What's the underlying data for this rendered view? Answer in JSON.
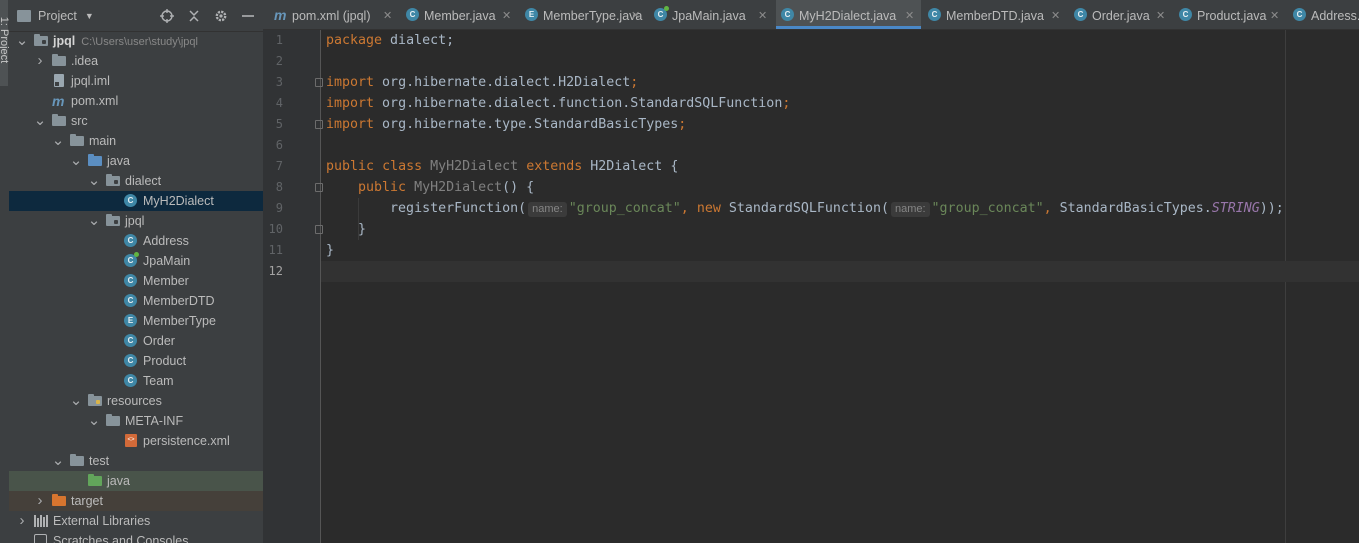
{
  "sidebar_tab_label": "1: Project",
  "panel": {
    "title": "Project",
    "icons": [
      "crosshair-icon",
      "collapse-all-icon",
      "gear-icon",
      "minimize-icon"
    ]
  },
  "tree": [
    {
      "label": "jpql",
      "path": "C:\\Users\\user\\study\\jpql",
      "icon": "module-folder",
      "level": 0,
      "expanded": true
    },
    {
      "label": ".idea",
      "icon": "folder",
      "level": 1,
      "expanded": false
    },
    {
      "label": "jpql.iml",
      "icon": "iml-file",
      "level": 1
    },
    {
      "label": "pom.xml",
      "icon": "maven-file",
      "level": 1
    },
    {
      "label": "src",
      "icon": "folder",
      "level": 1,
      "expanded": true
    },
    {
      "label": "main",
      "icon": "folder",
      "level": 2,
      "expanded": true
    },
    {
      "label": "java",
      "icon": "source-folder",
      "level": 3,
      "expanded": true
    },
    {
      "label": "dialect",
      "icon": "package",
      "level": 4,
      "expanded": true
    },
    {
      "label": "MyH2Dialect",
      "icon": "class",
      "level": 5,
      "selected": true
    },
    {
      "label": "jpql",
      "icon": "package",
      "level": 4,
      "expanded": true
    },
    {
      "label": "Address",
      "icon": "class",
      "level": 5
    },
    {
      "label": "JpaMain",
      "icon": "main-class",
      "level": 5
    },
    {
      "label": "Member",
      "icon": "class",
      "level": 5
    },
    {
      "label": "MemberDTD",
      "icon": "class",
      "level": 5
    },
    {
      "label": "MemberType",
      "icon": "enum",
      "level": 5
    },
    {
      "label": "Order",
      "icon": "class",
      "level": 5
    },
    {
      "label": "Product",
      "icon": "class",
      "level": 5
    },
    {
      "label": "Team",
      "icon": "class",
      "level": 5
    },
    {
      "label": "resources",
      "icon": "resources-folder",
      "level": 3,
      "expanded": true
    },
    {
      "label": "META-INF",
      "icon": "folder",
      "level": 4,
      "expanded": true
    },
    {
      "label": "persistence.xml",
      "icon": "xml-file",
      "level": 5
    },
    {
      "label": "test",
      "icon": "folder",
      "level": 2,
      "expanded": true
    },
    {
      "label": "java",
      "icon": "test-folder",
      "level": 3
    },
    {
      "label": "target",
      "icon": "excluded-folder",
      "level": 1,
      "expanded": false
    },
    {
      "label": "External Libraries",
      "icon": "libraries",
      "level": 0,
      "expanded": false
    },
    {
      "label": "Scratches and Consoles",
      "icon": "scratches",
      "level": 0
    }
  ],
  "tabs": [
    {
      "label": "pom.xml (jpql)",
      "icon": "maven-file",
      "close": true
    },
    {
      "label": "Member.java",
      "icon": "class",
      "close": true
    },
    {
      "label": "MemberType.java",
      "icon": "enum",
      "close": true
    },
    {
      "label": "JpaMain.java",
      "icon": "main-class",
      "close": true
    },
    {
      "label": "MyH2Dialect.java",
      "icon": "class",
      "close": true,
      "active": true
    },
    {
      "label": "MemberDTD.java",
      "icon": "class",
      "close": true
    },
    {
      "label": "Order.java",
      "icon": "class",
      "close": true
    },
    {
      "label": "Product.java",
      "icon": "class",
      "close": true
    },
    {
      "label": "Address.ja",
      "icon": "class",
      "close": false
    }
  ],
  "code": {
    "line_numbers": [
      "1",
      "2",
      "3",
      "4",
      "5",
      "6",
      "7",
      "8",
      "9",
      "10",
      "11",
      "12"
    ],
    "tokens": {
      "package_kw": "package",
      "package_name": " dialect;",
      "import_kw": "import",
      "import1": " org.hibernate.dialect.H2Dialect",
      "import2": " org.hibernate.dialect.function.StandardSQLFunction",
      "import3": " org.hibernate.type.StandardBasicTypes",
      "semi": ";",
      "public_kw": "public",
      "class_kw": "class",
      "class_name": "MyH2Dialect",
      "extends_kw": "extends",
      "super_name": "H2Dialect",
      "open_brace": " {",
      "ctor_name": "MyH2Dialect",
      "ctor_tail": "() {",
      "call_name": "registerFunction(",
      "hint_name": "name:",
      "str_arg": "\"group_concat\"",
      "comma": ", ",
      "new_kw": "new",
      "ctor_call": " StandardSQLFunction(",
      "types_ref": "StandardBasicTypes.",
      "string_const": "STRING",
      "close_call": "));",
      "inner_close": "}",
      "outer_close": "}"
    }
  }
}
